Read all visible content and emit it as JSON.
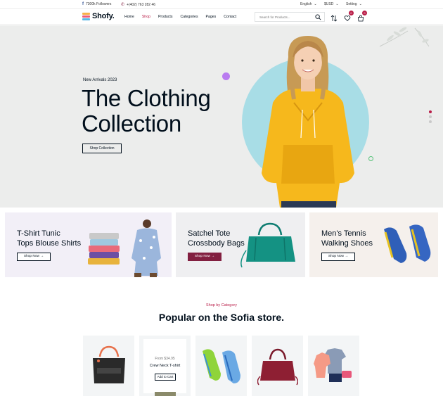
{
  "topbar": {
    "followers": "7300k Followers",
    "phone": "+(402) 763 282 46",
    "language": "English",
    "currency": "$USD",
    "setting": "Setting"
  },
  "header": {
    "logo": "Shofy.",
    "nav": [
      "Home",
      "Shop",
      "Products",
      "Categories",
      "Pages",
      "Contact"
    ],
    "active_nav": "Shop",
    "search_placeholder": "Search for Products...",
    "wishlist_count": "0",
    "cart_count": "0"
  },
  "hero": {
    "subtitle": "New Arrivals 2023",
    "title_line1": "The Clothing",
    "title_line2": "Collection",
    "button": "Shop Collection",
    "bg_color": "#ecedec",
    "circle_color": "#a8dde6"
  },
  "banners": [
    {
      "line1": "T-Shirt Tunic",
      "line2": "Tops Blouse Shirts",
      "button": "Shop Now →"
    },
    {
      "line1": "Satchel Tote",
      "line2": "Crossbody Bags",
      "button": "Shop Now →"
    },
    {
      "line1": "Men's Tennis",
      "line2": "Walking Shoes",
      "button": "Shop Now →"
    }
  ],
  "category": {
    "subtitle": "Shop by Category",
    "title": "Popular on the Sofia store.",
    "popup_price": "From $34.95",
    "popup_name": "Crew Neck T-shirt",
    "popup_button": "Add to Cart"
  },
  "colors": {
    "accent": "#b91c47",
    "primary": "#821f40",
    "text": "#010f1c"
  }
}
